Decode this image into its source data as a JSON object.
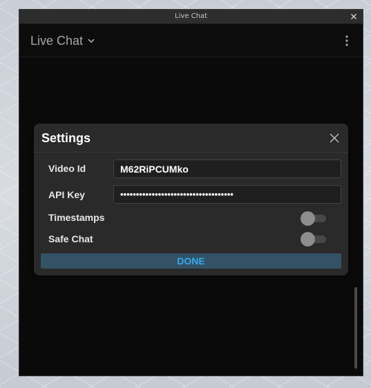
{
  "window": {
    "title": "Live Chat"
  },
  "header": {
    "title": "Live Chat"
  },
  "settings": {
    "title": "Settings",
    "video_id_label": "Video Id",
    "video_id_value": "M62RiPCUMko",
    "api_key_label": "API Key",
    "api_key_value": "••••••••••••••••••••••••••••••••••••",
    "timestamps_label": "Timestamps",
    "timestamps_on": false,
    "safe_chat_label": "Safe Chat",
    "safe_chat_on": false,
    "done_label": "DONE"
  },
  "colors": {
    "accent": "#36a8ec",
    "done_bg": "#335266",
    "dialog_bg": "#2a2a2a",
    "window_bg": "#0a0a0a"
  },
  "icons": {
    "window_close": "close-icon",
    "header_dropdown": "chevron-down-icon",
    "header_menu": "more-vertical-icon",
    "dialog_close": "close-icon"
  }
}
